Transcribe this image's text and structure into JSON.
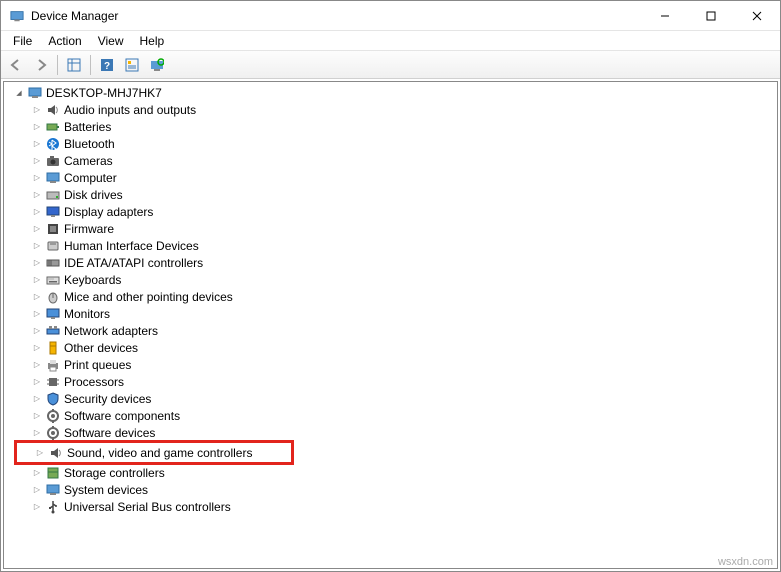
{
  "window": {
    "title": "Device Manager"
  },
  "menu": {
    "file": "File",
    "action": "Action",
    "view": "View",
    "help": "Help"
  },
  "tree": {
    "root": "DESKTOP-MHJ7HK7",
    "items": [
      {
        "label": "Audio inputs and outputs",
        "icon": "speaker"
      },
      {
        "label": "Batteries",
        "icon": "battery"
      },
      {
        "label": "Bluetooth",
        "icon": "bluetooth"
      },
      {
        "label": "Cameras",
        "icon": "camera"
      },
      {
        "label": "Computer",
        "icon": "computer"
      },
      {
        "label": "Disk drives",
        "icon": "disk"
      },
      {
        "label": "Display adapters",
        "icon": "display"
      },
      {
        "label": "Firmware",
        "icon": "firmware"
      },
      {
        "label": "Human Interface Devices",
        "icon": "hid"
      },
      {
        "label": "IDE ATA/ATAPI controllers",
        "icon": "ide"
      },
      {
        "label": "Keyboards",
        "icon": "keyboard"
      },
      {
        "label": "Mice and other pointing devices",
        "icon": "mouse"
      },
      {
        "label": "Monitors",
        "icon": "monitor"
      },
      {
        "label": "Network adapters",
        "icon": "network"
      },
      {
        "label": "Other devices",
        "icon": "other"
      },
      {
        "label": "Print queues",
        "icon": "printer"
      },
      {
        "label": "Processors",
        "icon": "cpu"
      },
      {
        "label": "Security devices",
        "icon": "security"
      },
      {
        "label": "Software components",
        "icon": "software"
      },
      {
        "label": "Software devices",
        "icon": "software"
      },
      {
        "label": "Sound, video and game controllers",
        "icon": "sound",
        "highlighted": true
      },
      {
        "label": "Storage controllers",
        "icon": "storage"
      },
      {
        "label": "System devices",
        "icon": "system"
      },
      {
        "label": "Universal Serial Bus controllers",
        "icon": "usb"
      }
    ]
  },
  "watermark": "wsxdn.com"
}
